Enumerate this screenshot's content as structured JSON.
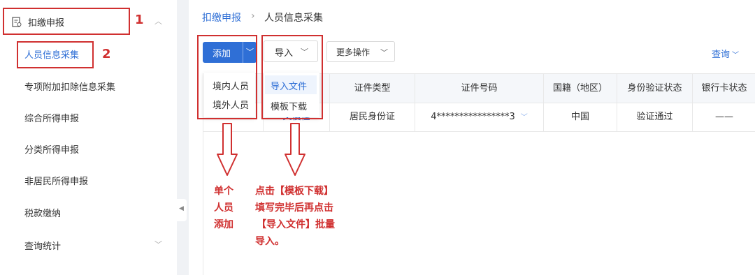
{
  "sidebar": {
    "group_label": "扣缴申报",
    "items": [
      {
        "label": "人员信息采集"
      },
      {
        "label": "专项附加扣除信息采集"
      },
      {
        "label": "综合所得申报"
      },
      {
        "label": "分类所得申报"
      },
      {
        "label": "非居民所得申报"
      },
      {
        "label": "税款缴纳"
      },
      {
        "label": "查询统计"
      }
    ]
  },
  "breadcrumb": {
    "parent": "扣缴申报",
    "current": "人员信息采集"
  },
  "toolbar": {
    "add": "添加",
    "import": "导入",
    "more": "更多操作",
    "query": "查询"
  },
  "add_menu": {
    "items": [
      "境内人员",
      "境外人员"
    ]
  },
  "import_menu": {
    "items": [
      "导入文件",
      "模板下载"
    ]
  },
  "table": {
    "headers": [
      "证件类型",
      "证件号码",
      "国籍（地区）",
      "身份验证状态",
      "银行卡状态"
    ],
    "row": {
      "name_link": "文慢怪",
      "id_type": "居民身份证",
      "id_number": "4****************3",
      "nationality": "中国",
      "verify_status": "验证通过",
      "bank_status": "——"
    }
  },
  "annotations": {
    "num1": "1",
    "num2": "2",
    "left_note": [
      "单个",
      "人员",
      "添加"
    ],
    "right_note": [
      "点击【模板下载】",
      "填写完毕后再点击",
      "【导入文件】批量",
      "导入。"
    ]
  },
  "colors": {
    "accent": "#2f6fd6",
    "annotation": "#d03030"
  }
}
